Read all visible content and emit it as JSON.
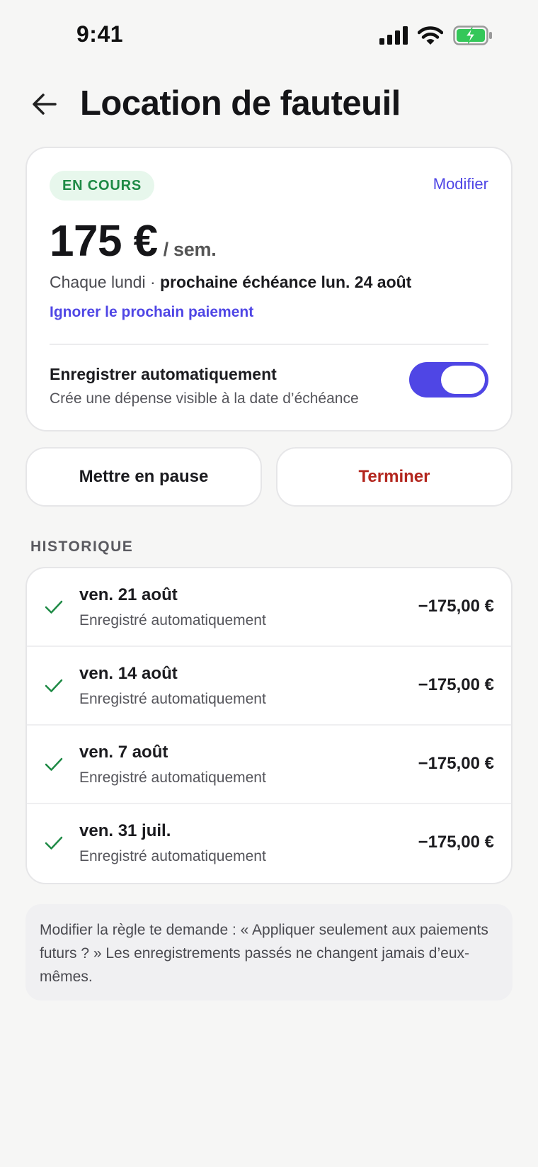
{
  "status_bar": {
    "time": "9:41"
  },
  "header": {
    "title": "Location de fauteuil"
  },
  "card": {
    "status_badge": "EN COURS",
    "edit_label": "Modifier",
    "amount": "175 €",
    "amount_unit": "/ sem.",
    "schedule_prefix": "Chaque lundi · ",
    "schedule_next": "prochaine échéance lun. 24 août",
    "skip_label": "Ignorer le prochain paiement",
    "auto_title": "Enregistrer automatiquement",
    "auto_subtitle": "Crée une dépense visible à la date d’échéance",
    "auto_enabled": true
  },
  "actions": {
    "pause_label": "Mettre en pause",
    "end_label": "Terminer"
  },
  "history": {
    "label": "HISTORIQUE",
    "items": [
      {
        "date": "ven. 21 août",
        "subtitle": "Enregistré automatiquement",
        "amount": "−175,00 €"
      },
      {
        "date": "ven. 14 août",
        "subtitle": "Enregistré automatiquement",
        "amount": "−175,00 €"
      },
      {
        "date": "ven. 7 août",
        "subtitle": "Enregistré automatiquement",
        "amount": "−175,00 €"
      },
      {
        "date": "ven. 31 juil.",
        "subtitle": "Enregistré automatiquement",
        "amount": "−175,00 €"
      }
    ]
  },
  "note": "Modifier la règle te demande : « Appliquer seulement aux paiements futurs ? » Les enregistrements passés ne changent jamais d’eux-mêmes.",
  "colors": {
    "accent": "#4f46e5",
    "success": "#1e8a45",
    "danger": "#b3261e",
    "battery": "#34c759"
  },
  "icons": [
    "back-arrow-icon",
    "signal-icon",
    "wifi-icon",
    "battery-charging-icon",
    "check-icon"
  ]
}
